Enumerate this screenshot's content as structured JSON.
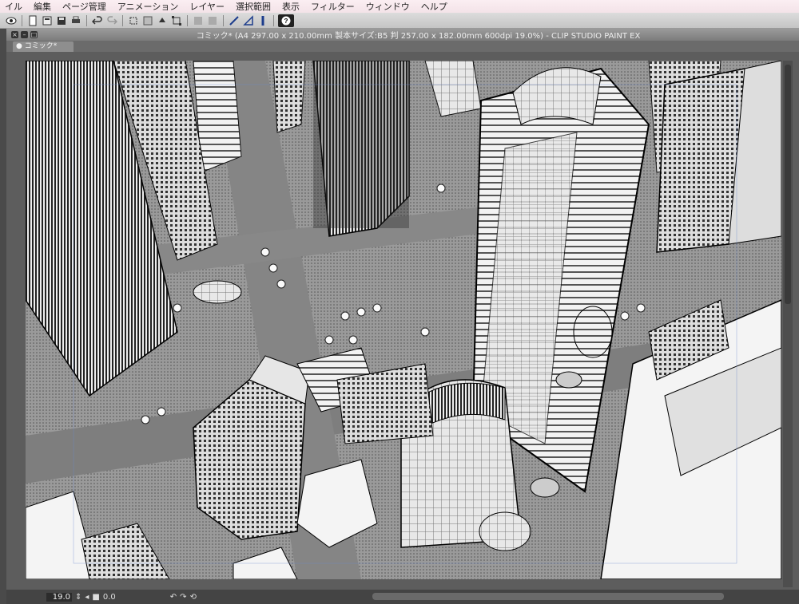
{
  "menu": [
    "イル",
    "編集",
    "ページ管理",
    "アニメーション",
    "レイヤー",
    "選択範囲",
    "表示",
    "フィルター",
    "ウィンドウ",
    "ヘルプ"
  ],
  "window": {
    "title": "コミック* (A4 297.00 x 210.00mm 製本サイズ:B5 判 257.00 x 182.00mm 600dpi 19.0%)  - CLIP STUDIO PAINT EX",
    "tab_label": "コミック*"
  },
  "status": {
    "zoom": "19.0",
    "angle": "0.0"
  },
  "toolbar_icons": [
    "app-logo-icon",
    "new-file-icon",
    "open-file-icon",
    "save-icon",
    "print-icon",
    "undo-icon",
    "redo-icon",
    "transform-icon",
    "snap-icon",
    "fill-icon",
    "pen-icon",
    "ruler-icon",
    "help-icon"
  ]
}
